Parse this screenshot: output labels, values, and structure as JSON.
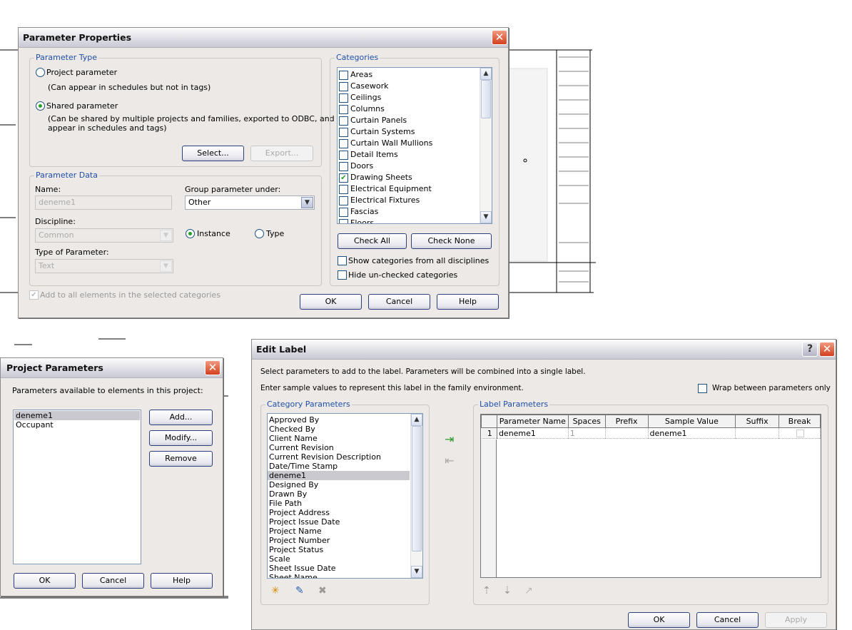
{
  "parameter_properties": {
    "title": "Parameter Properties",
    "parameter_type": {
      "group_label": "Parameter Type",
      "project_parameter": "Project parameter",
      "project_note": "(Can appear in schedules but not in tags)",
      "shared_parameter": "Shared parameter",
      "shared_note_1": "(Can be shared by multiple projects and families, exported to ODBC, and",
      "shared_note_2": "appear in schedules and tags)",
      "selected": "Shared parameter",
      "select_button": "Select...",
      "export_button": "Export..."
    },
    "parameter_data": {
      "group_label": "Parameter Data",
      "name_label": "Name:",
      "name_value": "deneme1",
      "group_under_label": "Group parameter under:",
      "group_under_value": "Other",
      "discipline_label": "Discipline:",
      "discipline_value": "Common",
      "instance_label": "Instance",
      "type_label": "Type",
      "instance_selected": true,
      "type_of_parameter_label": "Type of Parameter:",
      "type_of_parameter_value": "Text"
    },
    "add_to_all_label": "Add to all elements in the selected categories",
    "categories": {
      "group_label": "Categories",
      "items": [
        {
          "label": "Areas",
          "checked": false
        },
        {
          "label": "Casework",
          "checked": false
        },
        {
          "label": "Ceilings",
          "checked": false
        },
        {
          "label": "Columns",
          "checked": false
        },
        {
          "label": "Curtain Panels",
          "checked": false
        },
        {
          "label": "Curtain Systems",
          "checked": false
        },
        {
          "label": "Curtain Wall Mullions",
          "checked": false
        },
        {
          "label": "Detail Items",
          "checked": false
        },
        {
          "label": "Doors",
          "checked": false
        },
        {
          "label": "Drawing Sheets",
          "checked": true
        },
        {
          "label": "Electrical Equipment",
          "checked": false
        },
        {
          "label": "Electrical Fixtures",
          "checked": false
        },
        {
          "label": "Fascias",
          "checked": false
        },
        {
          "label": "Floors",
          "checked": false
        }
      ],
      "check_all": "Check All",
      "check_none": "Check None",
      "show_all_disciplines": "Show categories from all disciplines",
      "hide_unchecked": "Hide un-checked categories"
    },
    "ok": "OK",
    "cancel": "Cancel",
    "help": "Help"
  },
  "project_parameters": {
    "title": "Project Parameters",
    "label": "Parameters available to elements in this project:",
    "items": [
      "deneme1",
      "Occupant"
    ],
    "selected": "deneme1",
    "add": "Add...",
    "modify": "Modify...",
    "remove": "Remove",
    "ok": "OK",
    "cancel": "Cancel",
    "help": "Help"
  },
  "edit_label": {
    "title": "Edit Label",
    "help_icon": "?",
    "instruction_1": "Select parameters to add to the label.  Parameters will be combined into a single label.",
    "instruction_2": "Enter sample values to represent this label in the family environment.",
    "wrap_label": "Wrap between parameters only",
    "category_parameters": {
      "group_label": "Category Parameters",
      "items": [
        "Approved By",
        "Checked By",
        "Client Name",
        "Current Revision",
        "Current Revision Description",
        "Date/Time Stamp",
        "deneme1",
        "Designed By",
        "Drawn By",
        "File Path",
        "Project Address",
        "Project Issue Date",
        "Project Name",
        "Project Number",
        "Project Status",
        "Scale",
        "Sheet Issue Date",
        "Sheet Name"
      ],
      "selected": "deneme1"
    },
    "label_parameters": {
      "group_label": "Label Parameters",
      "columns": [
        "Parameter Name",
        "Spaces",
        "Prefix",
        "Sample Value",
        "Suffix",
        "Break"
      ],
      "rows": [
        {
          "index": "1",
          "parameter_name": "deneme1",
          "spaces": "1",
          "prefix": "",
          "sample_value": "deneme1",
          "suffix": "",
          "break": false
        }
      ]
    },
    "ok": "OK",
    "cancel": "Cancel",
    "apply": "Apply"
  }
}
